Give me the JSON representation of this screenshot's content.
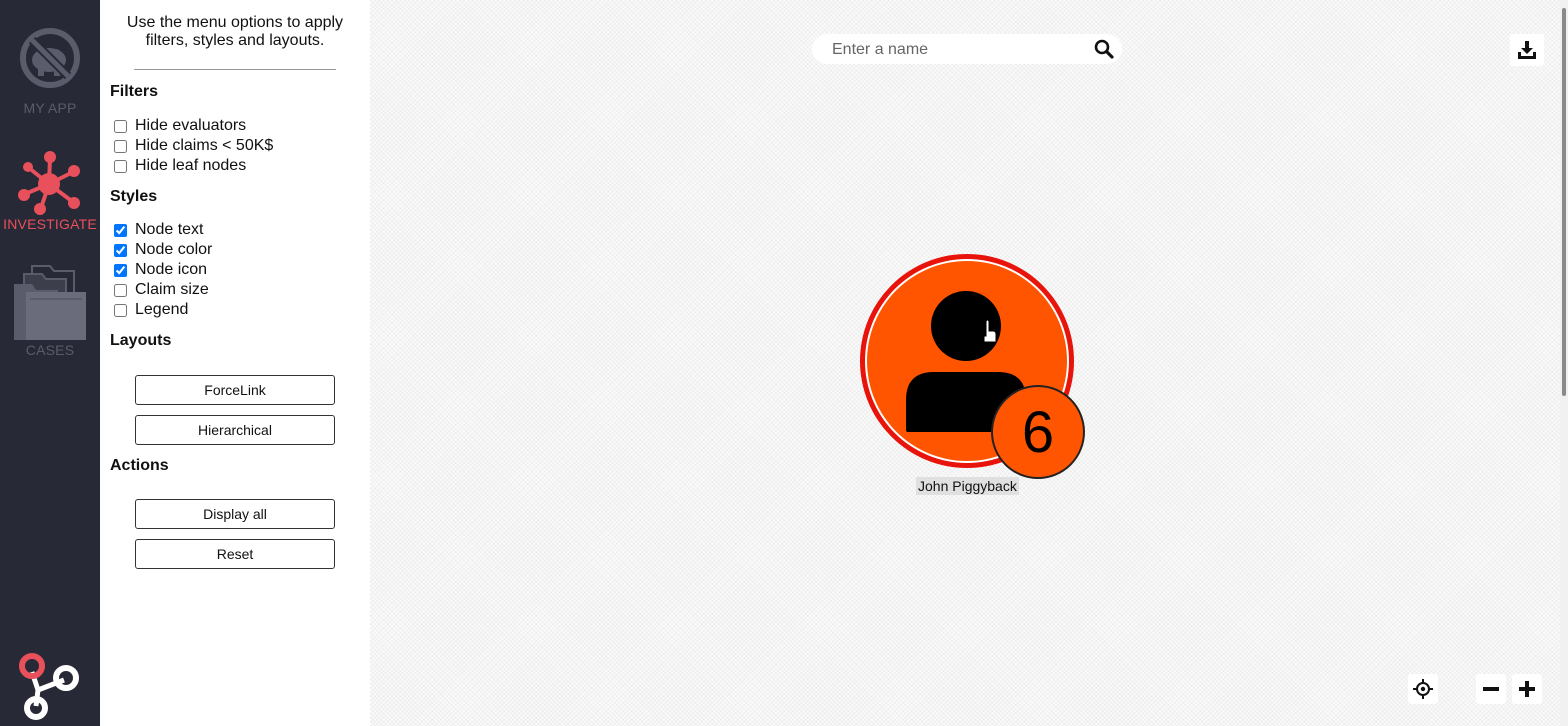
{
  "nav": {
    "my_app_label": "MY APP",
    "investigate_label": "INVESTIGATE",
    "cases_label": "CASES"
  },
  "panel": {
    "intro": "Use the menu options to apply filters, styles and layouts.",
    "filters": {
      "title": "Filters",
      "items": [
        {
          "label": "Hide evaluators",
          "checked": false
        },
        {
          "label": "Hide claims < 50K$",
          "checked": false
        },
        {
          "label": "Hide leaf nodes",
          "checked": false
        }
      ]
    },
    "styles": {
      "title": "Styles",
      "items": [
        {
          "label": "Node text",
          "checked": true
        },
        {
          "label": "Node color",
          "checked": true
        },
        {
          "label": "Node icon",
          "checked": true
        },
        {
          "label": "Claim size",
          "checked": false
        },
        {
          "label": "Legend",
          "checked": false
        }
      ]
    },
    "layouts": {
      "title": "Layouts",
      "buttons": [
        "ForceLink",
        "Hierarchical"
      ]
    },
    "actions": {
      "title": "Actions",
      "buttons": [
        "Display all",
        "Reset"
      ]
    }
  },
  "search": {
    "placeholder": "Enter a name",
    "value": ""
  },
  "graph": {
    "node": {
      "label": "John Piggyback",
      "badge": "6",
      "icon": "person-icon",
      "fill_color": "#ff5500",
      "ring_color": "#e8140c"
    }
  },
  "colors": {
    "nav_background": "#272936",
    "accent": "#e8505b",
    "nav_inactive": "#5a5c6b"
  },
  "icons": {
    "my_app": "no-piggy-bank-icon",
    "investigate": "network-icon",
    "cases": "folders-icon",
    "logo": "graph-logo-icon",
    "search": "search-icon",
    "download": "download-icon",
    "locate": "crosshair-icon",
    "zoom_out": "minus-icon",
    "zoom_in": "plus-icon"
  }
}
